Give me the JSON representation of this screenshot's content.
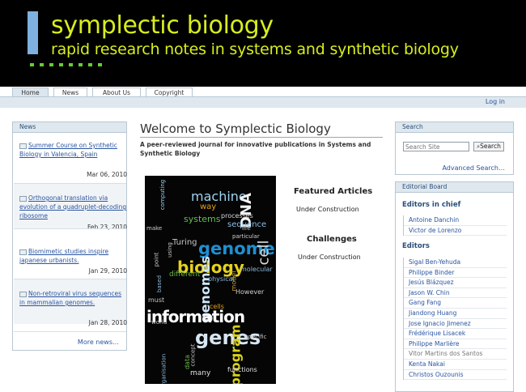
{
  "site": {
    "title": "symplectic biology",
    "subtitle": "rapid research notes in systems and synthetic biology"
  },
  "nav": {
    "tabs": [
      "Home",
      "News",
      "About Us",
      "Copyright"
    ],
    "login": "Log in"
  },
  "news": {
    "header": "News",
    "items": [
      {
        "title": "Summer Course on Synthetic Biology in Valencia, Spain",
        "date": "Mar 06, 2010"
      },
      {
        "title": "Orthogonal translation via evolution of a quadruplet-decoding ribosome",
        "date": "Feb 23, 2010"
      },
      {
        "title": "Biomimetic studies inspire japanese urbanists.",
        "date": "Jan 29, 2010"
      },
      {
        "title": "Non-retroviral virus sequences in mammalian genomes.",
        "date": "Jan 28, 2010"
      }
    ],
    "more": "More news…"
  },
  "main": {
    "title": "Welcome to Symplectic Biology",
    "description": "A peer-reviewed journal for innovative publications in Systems and Synthetic Biology",
    "featured_heading": "Featured Articles",
    "featured_text": "Under Construction",
    "challenges_heading": "Challenges",
    "challenges_text": "Under Construction"
  },
  "cloud": {
    "words": [
      "machine",
      "DNA",
      "genome",
      "biology",
      "genomes",
      "information",
      "genes",
      "program",
      "systems",
      "sequence",
      "cell",
      "Turing",
      "way",
      "computing",
      "processes",
      "different",
      "model",
      "physical",
      "functions",
      "organisation",
      "However",
      "particular",
      "concept",
      "life",
      "must",
      "data",
      "cells",
      "molecular",
      "point",
      "specific",
      "make",
      "based",
      "many",
      "world",
      "using"
    ]
  },
  "search": {
    "header": "Search",
    "placeholder": "Search Site",
    "button": "Search",
    "advanced": "Advanced Search…"
  },
  "editorial": {
    "header": "Editorial Board",
    "chiefs_heading": "Editors in chief",
    "chiefs": [
      "Antoine Danchin",
      "Victor de Lorenzo"
    ],
    "editors_heading": "Editors",
    "editors": [
      "Sigal Ben-Yehuda",
      "Philippe Binder",
      "Jesús Blázquez",
      "Jason W. Chin",
      "Gang Fang",
      "Jiandong Huang",
      "Jose Ignacio Jimenez",
      "Frédérique Lisacek",
      "Philippe Marlière",
      "Vitor Martins dos Santos",
      "Kenta Nakai",
      "Christos Ouzounis"
    ]
  },
  "colors": {
    "banner_bg": "#000000",
    "title_color": "#d8ee1c",
    "accent_bar": "#7fb0e0",
    "dots": "#66cc33",
    "link": "#2a55a0"
  }
}
